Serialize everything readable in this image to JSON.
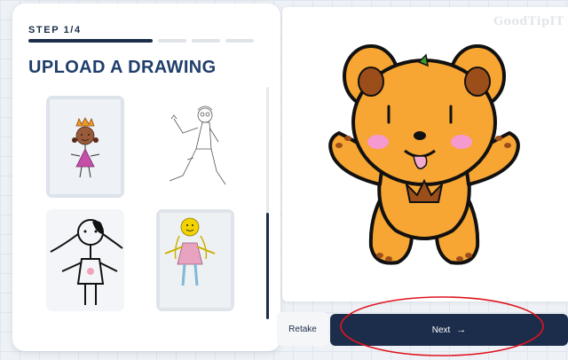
{
  "left_panel": {
    "step_label": "STEP 1/4",
    "progress": {
      "total_steps": 4,
      "current_step": 1
    },
    "title": "UPLOAD A DRAWING",
    "drawings": [
      {
        "name": "girl-with-crown-drawing"
      },
      {
        "name": "pencil-person-drawing"
      },
      {
        "name": "stick-girl-drawing"
      },
      {
        "name": "yellow-girl-drawing"
      }
    ]
  },
  "canvas": {
    "watermark": "GoodTipIT",
    "drawing": "orange-bear-drawing"
  },
  "actions": {
    "retake_label": "Retake",
    "next_label": "Next",
    "next_icon": "→"
  },
  "colors": {
    "navy": "#1b2d4a",
    "title_blue": "#203e6b",
    "bear_orange": "#f7a533",
    "annotation_red": "#e0141e"
  }
}
